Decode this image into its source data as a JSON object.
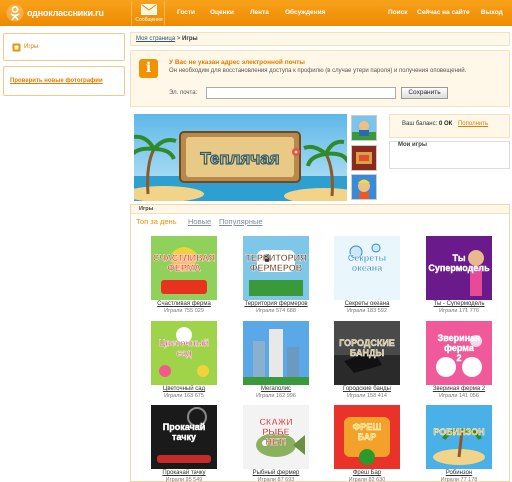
{
  "header": {
    "logo_text": "одноклассники.ru",
    "messages_label": "Сообщения",
    "nav": [
      "Гости",
      "Оценки",
      "Лента",
      "Обсуждения",
      "Поиск",
      "Сейчас на сайте",
      "Выход"
    ]
  },
  "sidebar": {
    "games_label": "Игры",
    "check_photos_label": "Проверить новые фотографии"
  },
  "breadcrumb": {
    "home": "Моя страница",
    "separator": " > ",
    "current": "Игры"
  },
  "email_notice": {
    "title": "У Вас не указан адрес электронной почты",
    "text": "Он необходим для восстановления доступа к профилю (в случае утери пароля) и получения оповещений.",
    "field_label": "Эл. почта:",
    "field_value": "",
    "save_label": "Сохранить"
  },
  "banner": {
    "title": "Теплячая"
  },
  "balance": {
    "label": "Ваш баланс:",
    "value": "0 ОК",
    "topup": "Пополнить"
  },
  "my_games": {
    "title": "Мои игры"
  },
  "games": {
    "title": "Игры",
    "tabs": [
      "Топ за день",
      "Новые",
      "Популярные"
    ],
    "items": [
      {
        "name": "Счастливая ферма",
        "players": "Играли 755 029",
        "art": "СЧАСТЛИВАЯ ФЕРМА"
      },
      {
        "name": "Территория фермеров",
        "players": "Играли 574 688",
        "art": "ТЕРРИТОРИЯ ФЕРМЕРОВ"
      },
      {
        "name": "Секреты океана",
        "players": "Играли 183 592",
        "art": "Секреты океана"
      },
      {
        "name": "Ты - Супермодель",
        "players": "Играли 171 776",
        "art": "Ты Супермодель"
      },
      {
        "name": "Цветочный сад",
        "players": "Играли 163 675",
        "art": "Цветочный сад"
      },
      {
        "name": "Мегаполис",
        "players": "Играли 162 996",
        "art": ""
      },
      {
        "name": "Городские банды",
        "players": "Играли 158 414",
        "art": "ГОРОДСКИЕ БАНДЫ"
      },
      {
        "name": "Звериная ферма 2",
        "players": "Играли 141 056",
        "art": "Звериная ферма 2"
      },
      {
        "name": "Прокачай тачку",
        "players": "Играли 95 549",
        "art": "Прокачай тачку"
      },
      {
        "name": "Рыбный фермер",
        "players": "Играли 87 693",
        "art": "СКАЖИ РЫБЕ НЕТ!"
      },
      {
        "name": "Фреш Бар",
        "players": "Играли 82 630",
        "art": "ФРЕШ БАР"
      },
      {
        "name": "Робинзон",
        "players": "Играли 77 178",
        "art": "РОБИНЗОН"
      }
    ]
  },
  "colors": {
    "brand_orange": "#f29100",
    "link_blue": "#2b587a",
    "panel_bg": "#fff8e8"
  }
}
